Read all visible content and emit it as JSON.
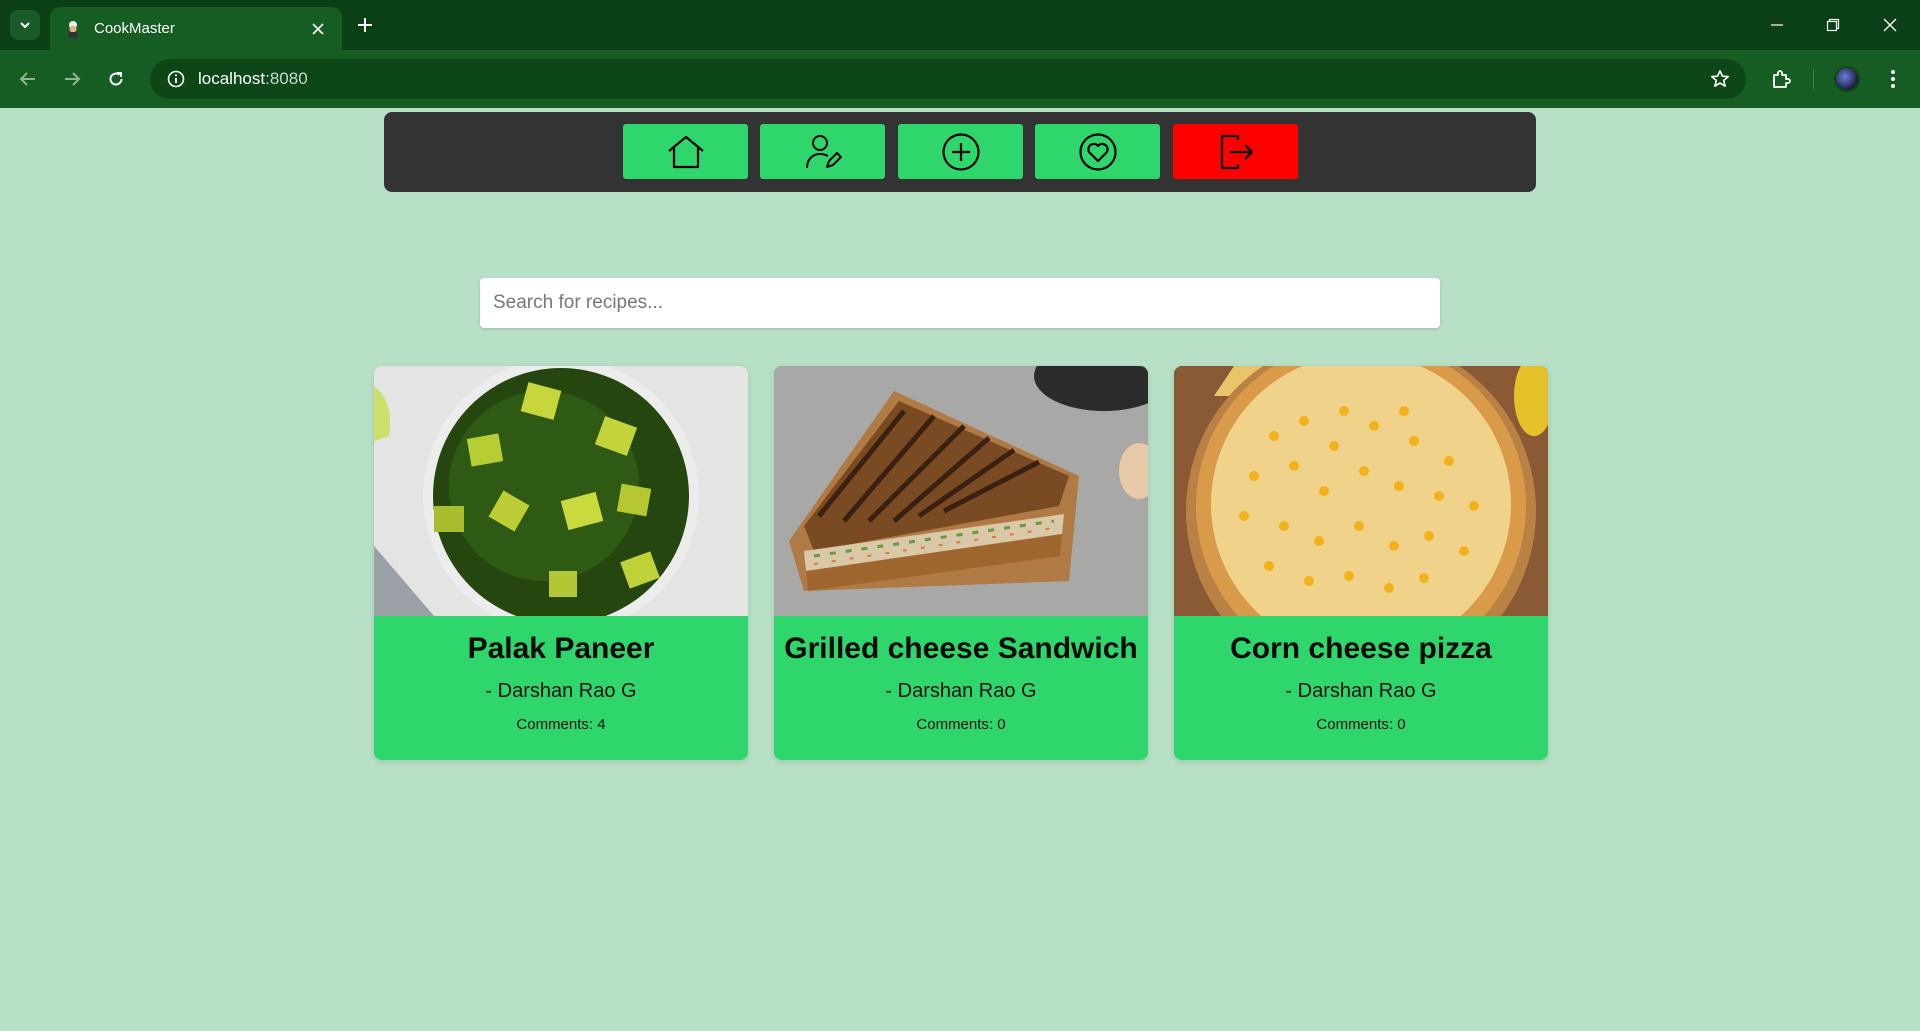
{
  "browser": {
    "tab_title": "CookMaster",
    "url_host": "localhost",
    "url_port": ":8080"
  },
  "nav": {
    "buttons": [
      {
        "icon": "home-icon"
      },
      {
        "icon": "user-edit-icon"
      },
      {
        "icon": "add-circle-icon"
      },
      {
        "icon": "heart-circle-icon"
      },
      {
        "icon": "logout-icon"
      }
    ]
  },
  "search": {
    "placeholder": "Search for recipes..."
  },
  "recipes": [
    {
      "title": "Palak Paneer",
      "author": "- Darshan Rao G",
      "comments": "Comments: 4"
    },
    {
      "title": "Grilled cheese Sandwich",
      "author": "- Darshan Rao G",
      "comments": "Comments: 0"
    },
    {
      "title": "Corn cheese pizza",
      "author": "- Darshan Rao G",
      "comments": "Comments: 0"
    }
  ],
  "colors": {
    "page_bg": "#b7e0c6",
    "nav_bg": "#333333",
    "accent_green": "#2ed66b",
    "logout_red": "#ff0000",
    "chrome_dark": "#0b4016",
    "chrome_toolbar": "#155d22"
  }
}
